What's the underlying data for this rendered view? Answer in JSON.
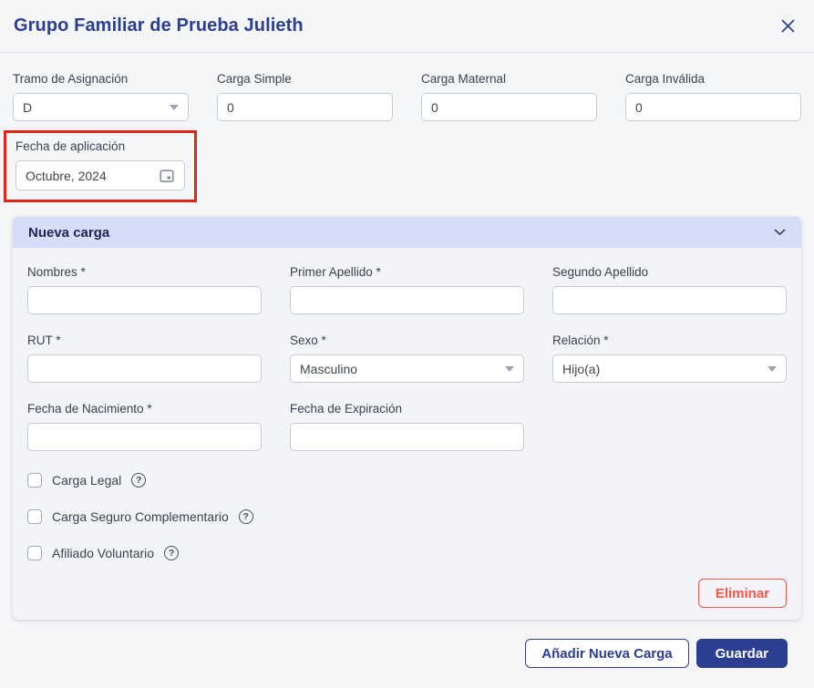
{
  "header": {
    "title": "Grupo Familiar de Prueba Julieth",
    "close_icon": "close-x-icon"
  },
  "colors": {
    "accent_blue": "#2B3E92",
    "panel_header_bg": "#D6DDF6",
    "panel_title_text": "#1B2559",
    "background": "#F5F6F8",
    "danger_red": "#F5554A",
    "annotation_red": "#E02417",
    "input_border": "#C6CBD5"
  },
  "top_fields": [
    {
      "label": "Tramo de Asignación",
      "value": "D",
      "type": "select"
    },
    {
      "label": "Carga Simple",
      "value": "0",
      "type": "input"
    },
    {
      "label": "Carga Maternal",
      "value": "0",
      "type": "input"
    },
    {
      "label": "Carga Inválida",
      "value": "0",
      "type": "input"
    }
  ],
  "application_date": {
    "label": "Fecha de aplicación",
    "value": "Octubre, 2024",
    "icon": "calendar-icon",
    "annotation": "red-highlight-box"
  },
  "new_charge_panel": {
    "title": "Nueva carga",
    "chevron_icon": "chevron-down-icon",
    "fields": {
      "nombres": {
        "label": "Nombres *",
        "value": ""
      },
      "primer_apellido": {
        "label": "Primer Apellido *",
        "value": ""
      },
      "segundo_apellido": {
        "label": "Segundo Apellido",
        "value": ""
      },
      "rut": {
        "label": "RUT *",
        "value": ""
      },
      "sexo": {
        "label": "Sexo *",
        "value": "Masculino"
      },
      "relacion": {
        "label": "Relación *",
        "value": "Hijo(a)"
      },
      "fecha_nacimiento": {
        "label": "Fecha de Nacimiento *",
        "value": ""
      },
      "fecha_expiracion": {
        "label": "Fecha de Expiración",
        "value": ""
      }
    },
    "checkboxes": [
      {
        "label": "Carga Legal",
        "checked": false,
        "help": "?"
      },
      {
        "label": "Carga Seguro Complementario",
        "checked": false,
        "help": "?"
      },
      {
        "label": "Afiliado Voluntario",
        "checked": false,
        "help": "?"
      }
    ],
    "delete_button_label": "Eliminar"
  },
  "footer": {
    "add_button_label": "Añadir Nueva Carga",
    "save_button_label": "Guardar"
  }
}
